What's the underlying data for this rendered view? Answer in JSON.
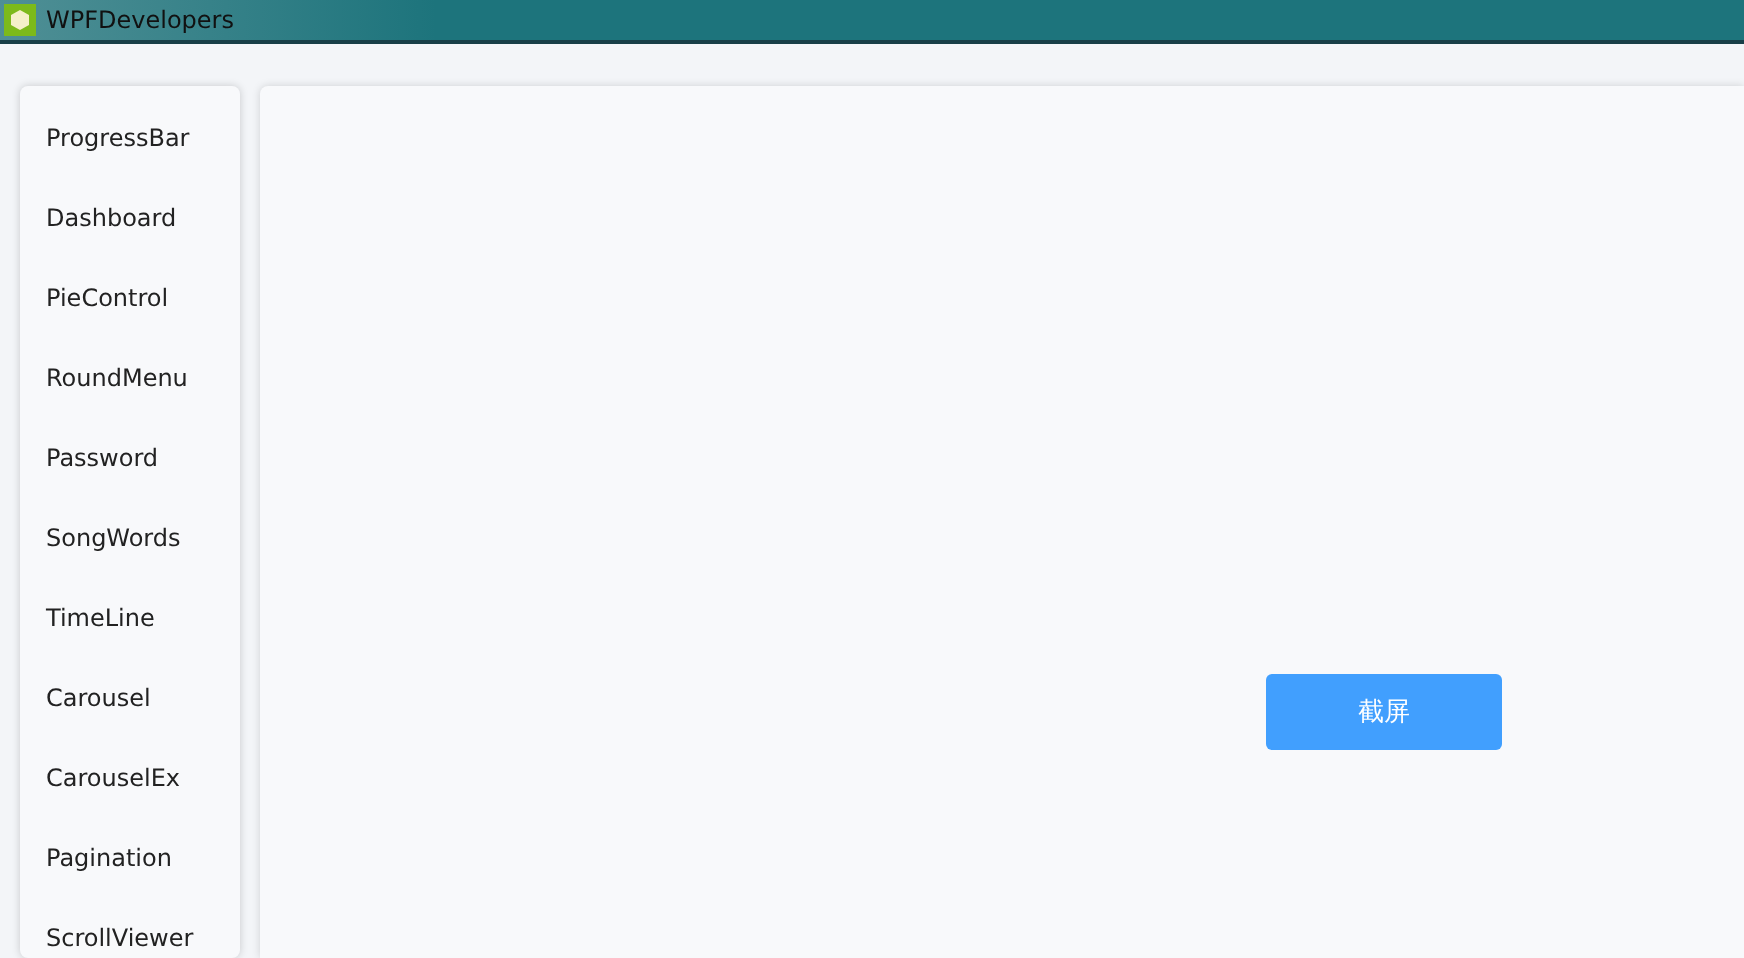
{
  "window": {
    "title": "WPFDevelopers"
  },
  "sidebar": {
    "items": [
      "ProgressBar",
      "Dashboard",
      "PieControl",
      "RoundMenu",
      "Password",
      "SongWords",
      "TimeLine",
      "Carousel",
      "CarouselEx",
      "Pagination",
      "ScrollViewer"
    ]
  },
  "main": {
    "button": "截屏"
  }
}
